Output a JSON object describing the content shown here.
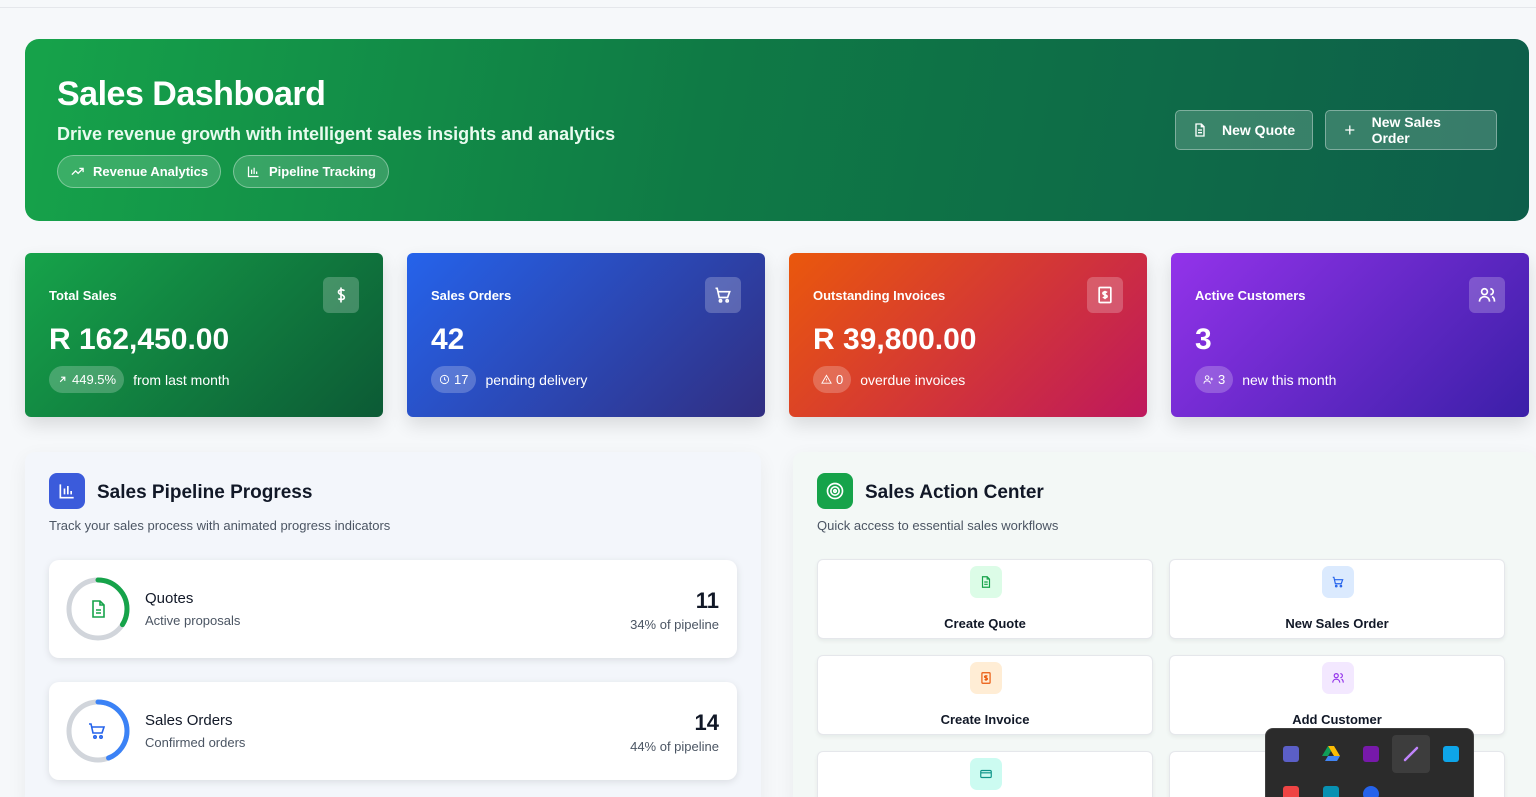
{
  "hero": {
    "title": "Sales Dashboard",
    "subtitle": "Drive revenue growth with intelligent sales insights and analytics",
    "pills": [
      "Revenue Analytics",
      "Pipeline Tracking"
    ],
    "buttons": {
      "new_quote": "New Quote",
      "new_sales_order": "New Sales Order"
    }
  },
  "stats": [
    {
      "label": "Total Sales",
      "value": "R 162,450.00",
      "chip": "449.5%",
      "note": "from last month",
      "icon": "dollar-icon",
      "color_from": "#16a34a",
      "color_to": "#0c5a35"
    },
    {
      "label": "Sales Orders",
      "value": "42",
      "chip": "17",
      "note": "pending delivery",
      "icon": "cart-icon",
      "color_from": "#2563eb",
      "color_to": "#312e81"
    },
    {
      "label": "Outstanding Invoices",
      "value": "R 39,800.00",
      "chip": "0",
      "note": "overdue invoices",
      "icon": "invoice-icon",
      "color_from": "#ea580c",
      "color_to": "#be185d"
    },
    {
      "label": "Active Customers",
      "value": "3",
      "chip": "3",
      "note": "new this month",
      "icon": "users-icon",
      "color_from": "#9333ea",
      "color_to": "#3b1fa8"
    }
  ],
  "pipeline": {
    "title": "Sales Pipeline Progress",
    "description": "Track your sales process with animated progress indicators",
    "items": [
      {
        "name": "Quotes",
        "sub": "Active proposals",
        "count": "11",
        "pct_label": "34% of pipeline",
        "progress": 0.34,
        "color": "#16a34a",
        "icon": "document-icon"
      },
      {
        "name": "Sales Orders",
        "sub": "Confirmed orders",
        "count": "14",
        "pct_label": "44% of pipeline",
        "progress": 0.44,
        "color": "#3b82f6",
        "icon": "cart-icon"
      }
    ]
  },
  "actions": {
    "title": "Sales Action Center",
    "description": "Quick access to essential sales workflows",
    "items": [
      {
        "label": "Create Quote",
        "icon": "document-icon",
        "bg": "#dcfce7",
        "fg": "#16a34a"
      },
      {
        "label": "New Sales Order",
        "icon": "cart-icon",
        "bg": "#dbeafe",
        "fg": "#2563eb"
      },
      {
        "label": "Create Invoice",
        "icon": "invoice-icon",
        "bg": "#ffedd5",
        "fg": "#ea580c"
      },
      {
        "label": "Add Customer",
        "icon": "users-icon",
        "bg": "#f3e8ff",
        "fg": "#9333ea"
      },
      {
        "label": "",
        "icon": "card-icon",
        "bg": "#ccfbf1",
        "fg": "#0d9488"
      },
      {
        "label": "",
        "icon": "",
        "bg": "#ffffff",
        "fg": "#ffffff"
      }
    ]
  },
  "tray": {
    "icons": [
      "teams-icon",
      "google-drive-icon",
      "onenote-icon",
      "pen-icon",
      "window-icon",
      "app-icon",
      "shield-icon",
      "bluetooth-icon"
    ]
  }
}
